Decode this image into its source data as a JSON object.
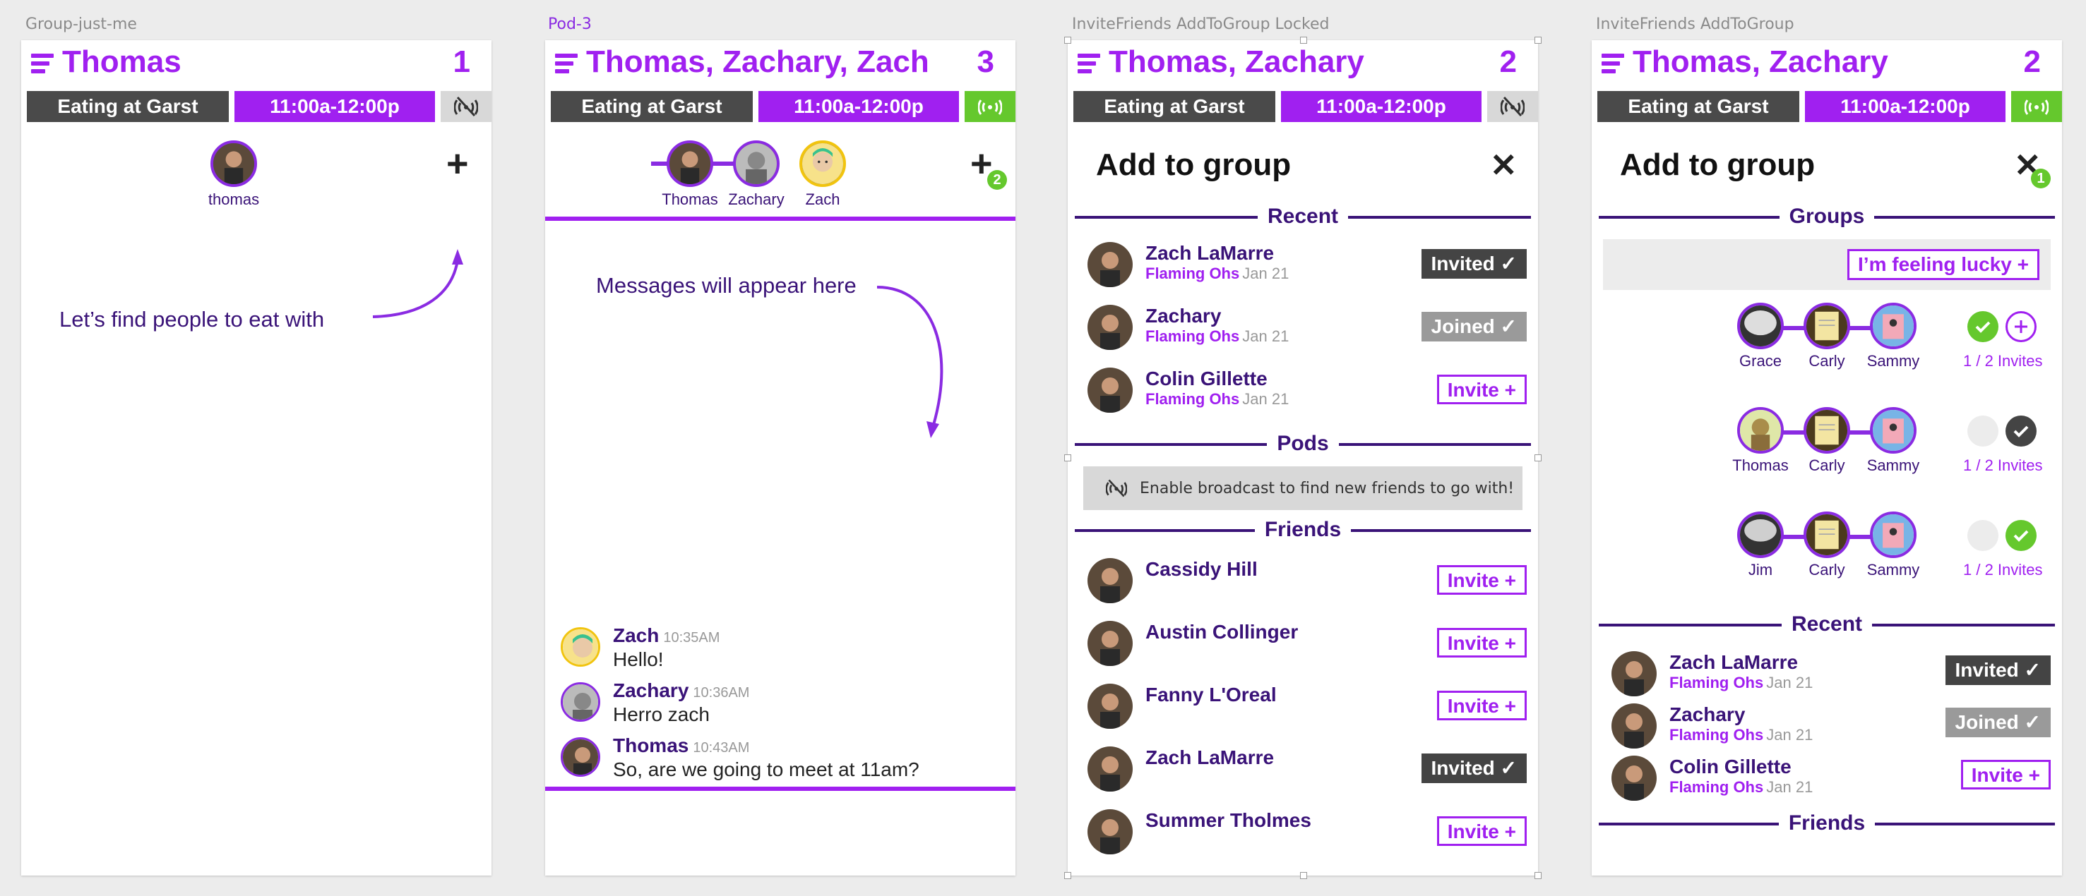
{
  "artboards": [
    {
      "label": "Group-just-me",
      "header": {
        "title": "Thomas",
        "count": "1"
      },
      "event": {
        "place": "Eating at Garst",
        "time": "11:00a-12:00p",
        "broadcast": "off"
      },
      "members": [
        {
          "name": "thomas"
        }
      ],
      "hint": "Let’s find people to eat with"
    },
    {
      "label": "Pod-3",
      "header": {
        "title": "Thomas, Zachary, Zach",
        "count": "3"
      },
      "event": {
        "place": "Eating at Garst",
        "time": "11:00a-12:00p",
        "broadcast": "on"
      },
      "members": [
        {
          "name": "Thomas"
        },
        {
          "name": "Zachary"
        },
        {
          "name": "Zach"
        }
      ],
      "add_badge": "2",
      "hint": "Messages will appear here",
      "messages": [
        {
          "author": "Zach",
          "time": "10:35AM",
          "text": "Hello!"
        },
        {
          "author": "Zachary",
          "time": "10:36AM",
          "text": "Herro zach"
        },
        {
          "author": "Thomas",
          "time": "10:43AM",
          "text": "So, are we going to meet at 11am?"
        }
      ]
    },
    {
      "label": "InviteFriends AddToGroup Locked",
      "header": {
        "title": "Thomas, Zachary",
        "count": "2"
      },
      "event": {
        "place": "Eating at Garst",
        "time": "11:00a-12:00p",
        "broadcast": "off"
      },
      "panel_title": "Add to group",
      "sections": {
        "recent": "Recent",
        "pods": "Pods",
        "friends": "Friends"
      },
      "recent": [
        {
          "name": "Zach LaMarre",
          "group": "Flaming Ohs",
          "date": "Jan 21",
          "action": "Invited ✓"
        },
        {
          "name": "Zachary",
          "group": "Flaming Ohs",
          "date": "Jan 21",
          "action": "Joined ✓"
        },
        {
          "name": "Colin Gillette",
          "group": "Flaming Ohs",
          "date": "Jan 21",
          "action": "Invite +"
        }
      ],
      "broadcast_prompt": "Enable broadcast to find new friends to go with!",
      "friends": [
        {
          "name": "Cassidy Hill",
          "action": "Invite +"
        },
        {
          "name": "Austin Collinger",
          "action": "Invite +"
        },
        {
          "name": "Fanny L'Oreal",
          "action": "Invite +"
        },
        {
          "name": "Zach LaMarre",
          "action": "Invited ✓"
        },
        {
          "name": "Summer Tholmes",
          "action": "Invite +"
        }
      ]
    },
    {
      "label": "InviteFriends AddToGroup",
      "header": {
        "title": "Thomas, Zachary",
        "count": "2"
      },
      "event": {
        "place": "Eating at Garst",
        "time": "11:00a-12:00p",
        "broadcast": "on"
      },
      "panel_title": "Add to group",
      "close_badge": "1",
      "sections": {
        "groups": "Groups",
        "recent": "Recent",
        "friends": "Friends"
      },
      "lucky": "I’m feeling lucky +",
      "groups": [
        {
          "members": [
            "Grace",
            "Carly",
            "Sammy"
          ],
          "invites": "1 / 2 Invites"
        },
        {
          "members": [
            "Thomas",
            "Carly",
            "Sammy"
          ],
          "invites": "1 / 2 Invites"
        },
        {
          "members": [
            "Jim",
            "Carly",
            "Sammy"
          ],
          "invites": "1 / 2 Invites"
        }
      ],
      "recent": [
        {
          "name": "Zach LaMarre",
          "group": "Flaming Ohs",
          "date": "Jan 21",
          "action": "Invited ✓"
        },
        {
          "name": "Zachary",
          "group": "Flaming Ohs",
          "date": "Jan 21",
          "action": "Joined ✓"
        },
        {
          "name": "Colin Gillette",
          "group": "Flaming Ohs",
          "date": "Jan 21",
          "action": "Invite +"
        }
      ]
    }
  ],
  "colors": {
    "accent": "#a020f0",
    "dark_purple": "#3a1378",
    "green": "#65c82d",
    "dark_grey": "#4a4a4a"
  },
  "icons": {
    "menu": "hamburger-icon",
    "broadcast_off": "broadcast-off-icon",
    "broadcast_on": "broadcast-icon",
    "add": "plus-icon",
    "close": "close-icon",
    "check": "check-icon"
  }
}
